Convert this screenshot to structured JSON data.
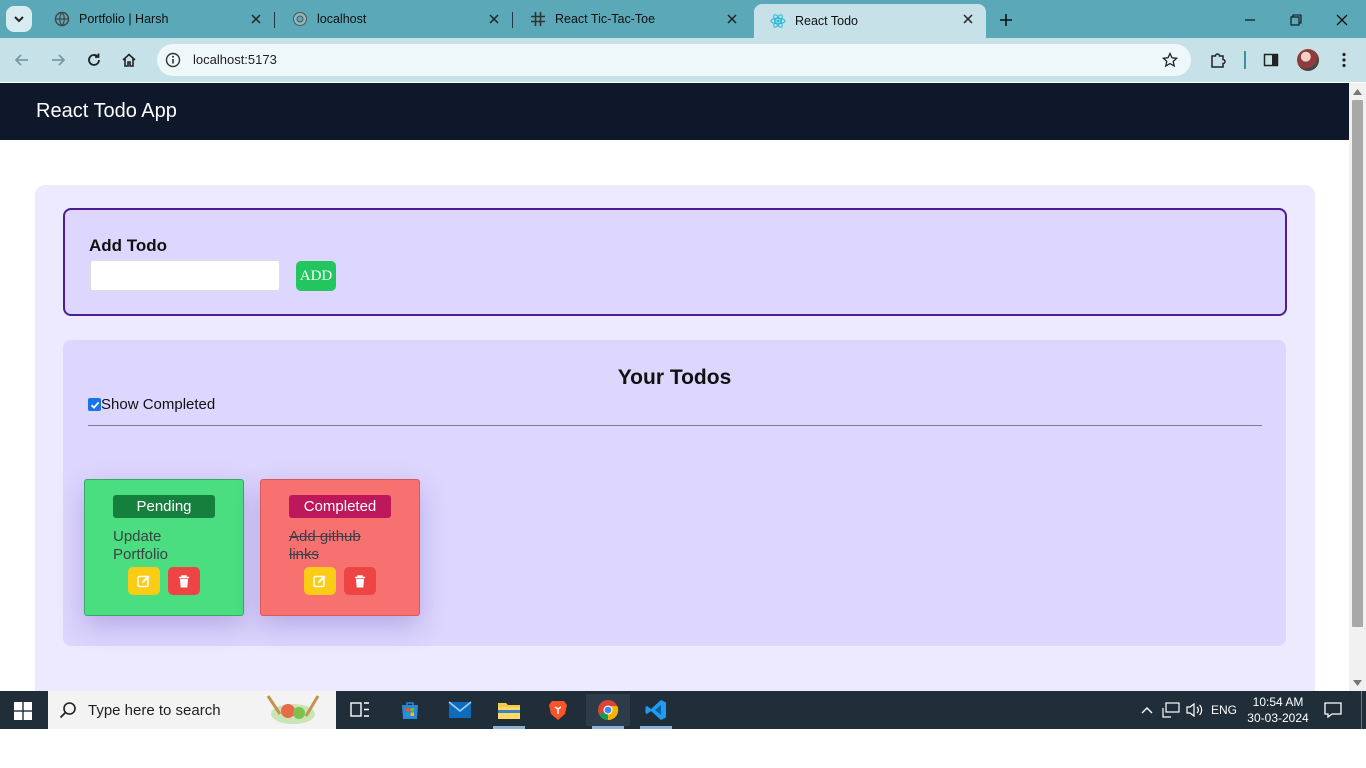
{
  "browser": {
    "tabs": [
      {
        "title": "Portfolio | Harsh",
        "active": false
      },
      {
        "title": "localhost",
        "active": false
      },
      {
        "title": "React Tic-Tac-Toe",
        "active": false
      },
      {
        "title": "React Todo",
        "active": true
      }
    ],
    "url": "localhost:5173",
    "colors": {
      "tabstrip": "#5aa8b8",
      "toolbar": "#c6e2e8"
    }
  },
  "app": {
    "navbar_title": "React Todo App",
    "add_section": {
      "title": "Add Todo",
      "input_value": "",
      "input_placeholder": "",
      "button_label": "ADD"
    },
    "list_section": {
      "heading": "Your Todos",
      "show_completed_label": "Show Completed",
      "show_completed_checked": true
    },
    "todos": [
      {
        "status": "Pending",
        "text": "Update Portfolio",
        "completed": false
      },
      {
        "status": "Completed",
        "text": "Add github links",
        "completed": true
      }
    ],
    "colors": {
      "navbar": "#0f172a",
      "pending": "#4ade80",
      "completed": "#f87171",
      "add_button": "#22c55e"
    }
  },
  "taskbar": {
    "search_placeholder": "Type here to search",
    "language": "ENG",
    "time": "10:54 AM",
    "date": "30-03-2024"
  }
}
